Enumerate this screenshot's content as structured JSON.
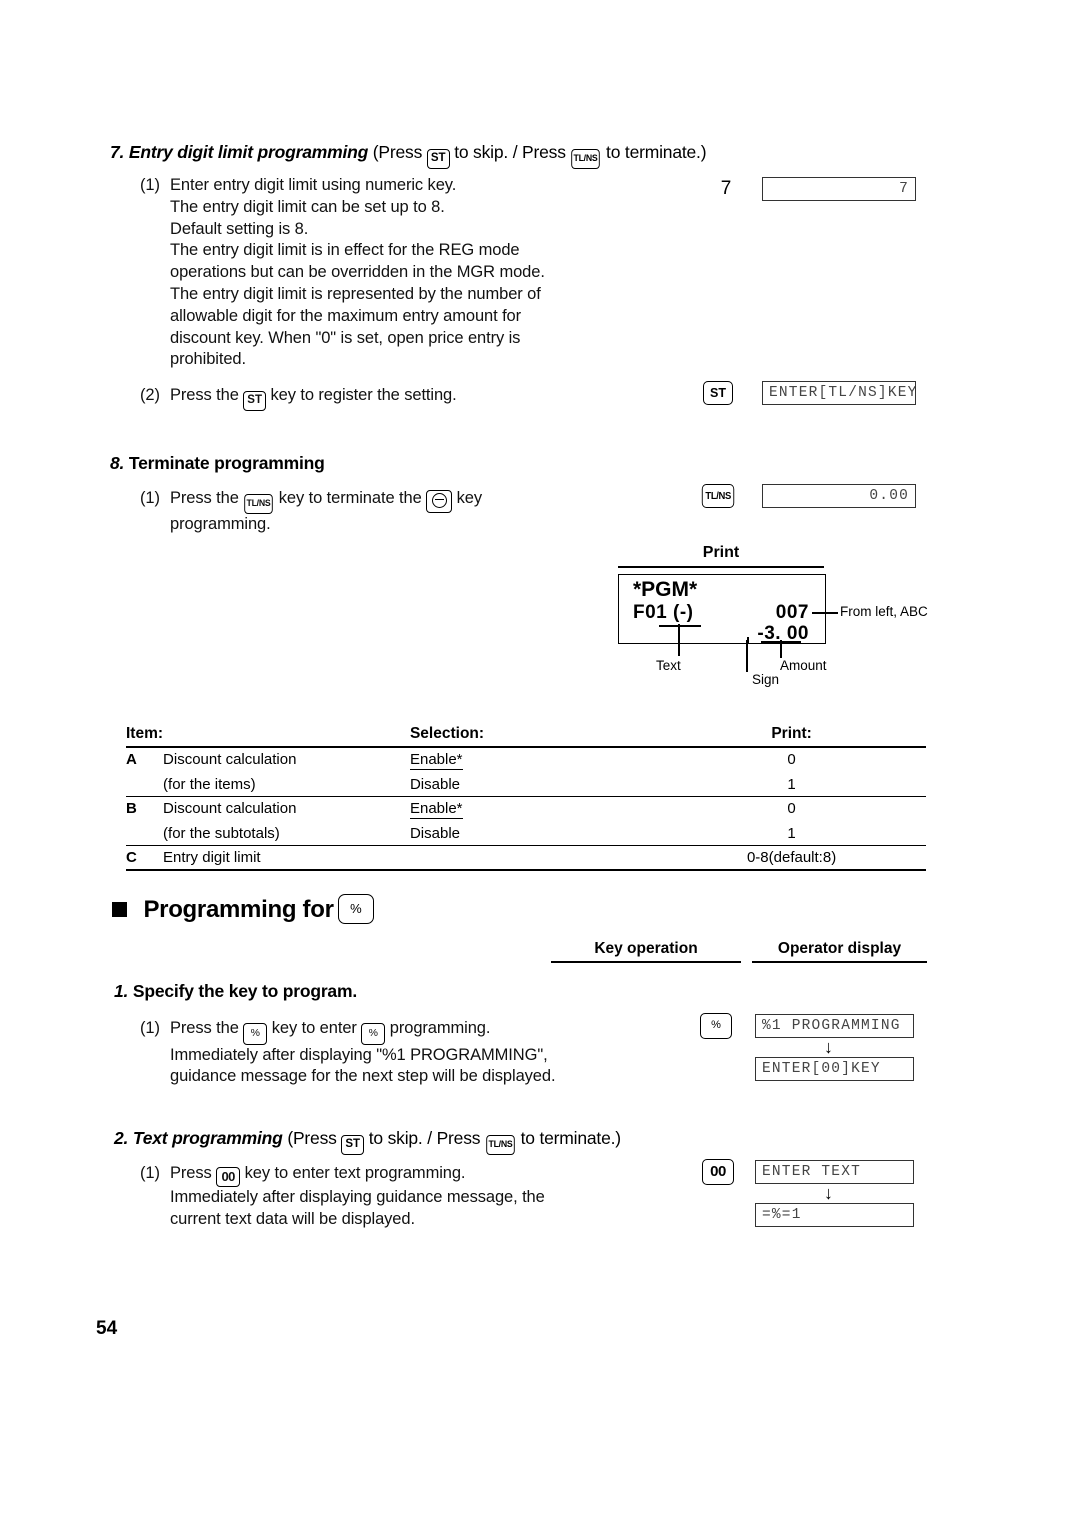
{
  "page": {
    "number": "54"
  },
  "section7": {
    "number": "7.",
    "title": "Entry digit limit programming",
    "note": "(Press",
    "skip_text": "to skip. / Press",
    "terminate_text": "to terminate.)",
    "key_st": "ST",
    "key_tlns": "TL/NS",
    "step1": {
      "marker": "(1)",
      "lines": [
        "Enter entry digit limit using numeric key.",
        "The entry digit limit can be set up to 8.",
        "Default setting is 8.",
        "The entry digit limit is in effect for the REG mode",
        "operations but can be overridden in the MGR mode.",
        "The entry digit limit is represented by the number of",
        "allowable digit for the maximum entry amount for",
        "discount key.  When \"0\" is set, open price entry is",
        "prohibited."
      ],
      "key_operation": "7",
      "display": "7"
    },
    "step2": {
      "marker": "(2)",
      "text_before": "Press the",
      "key": "ST",
      "text_after": "key to register the setting.",
      "display": "ENTER[TL/NS]KEY"
    }
  },
  "section8": {
    "number": "8.",
    "title": "Terminate programming",
    "step1": {
      "marker": "(1)",
      "text_before": "Press the",
      "key1": "TL/NS",
      "text_middle": "key to terminate the",
      "key2": "minus-key-icon",
      "text_after": "key",
      "line2": "programming.",
      "key_operation": "TL/NS",
      "display": "0.00"
    }
  },
  "print_sample": {
    "title": "Print",
    "line1": "*PGM*",
    "line2_prefix": "F",
    "line2_rest": "01  (-)",
    "line2_right": "007",
    "line3_right": "-3. 00",
    "callouts": {
      "from_left": "From left, ABC",
      "text": "Text",
      "sign": "Sign",
      "amount": "Amount"
    }
  },
  "table": {
    "headers": {
      "item": "Item:",
      "selection": "Selection:",
      "print": "Print:"
    },
    "rows": [
      {
        "letter": "A",
        "item": "Discount calculation",
        "selection": "Enable*",
        "selection_underline": true,
        "print": "0",
        "rule": "thin"
      },
      {
        "letter": "",
        "item": "(for the items)",
        "selection": "Disable",
        "selection_underline": false,
        "print": "1",
        "rule": "thin"
      },
      {
        "letter": "B",
        "item": "Discount calculation",
        "selection": "Enable*",
        "selection_underline": true,
        "print": "0",
        "rule": "thin"
      },
      {
        "letter": "",
        "item": "(for the subtotals)",
        "selection": "Disable",
        "selection_underline": false,
        "print": "1",
        "rule": "thin"
      },
      {
        "letter": "C",
        "item": "Entry digit limit",
        "selection": "",
        "selection_underline": false,
        "print": "0-8(default:8)",
        "rule": "heavy"
      }
    ]
  },
  "programming_for": {
    "heading_text": "Programming for",
    "heading_key": "%",
    "columns": {
      "key_operation": "Key operation",
      "operator_display": "Operator display"
    }
  },
  "section_p1": {
    "number": "1.",
    "title": "Specify the key to program.",
    "step1": {
      "marker": "(1)",
      "text_before": "Press the",
      "key1": "%",
      "text_middle": "key to enter",
      "key2": "%",
      "text_after": "programming.",
      "line2": "Immediately after displaying \"%1 PROGRAMMING\",",
      "line3": "guidance message for the next step will be displayed.",
      "key_operation": "%",
      "display1": "%1 PROGRAMMING",
      "display2": "ENTER[00]KEY"
    }
  },
  "section_p2": {
    "number": "2.",
    "title": "Text programming",
    "note": "(Press",
    "skip_text": "to skip. / Press",
    "terminate_text": "to terminate.)",
    "key_st": "ST",
    "key_tlns": "TL/NS",
    "step1": {
      "marker": "(1)",
      "text_before": "Press",
      "key": "00",
      "text_after": "key to enter text programming.",
      "line2": "Immediately after displaying guidance message, the",
      "line3": "current text data will be displayed.",
      "key_operation": "00",
      "display1": "ENTER TEXT",
      "display2": "=%=1"
    }
  }
}
